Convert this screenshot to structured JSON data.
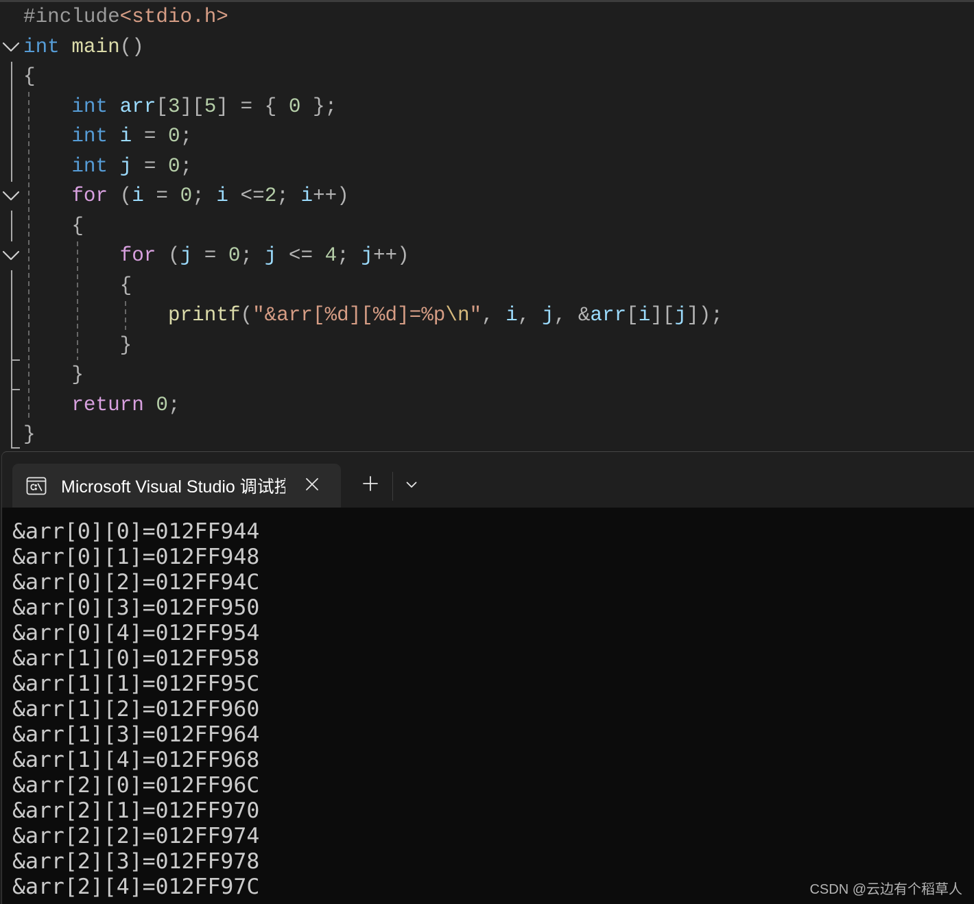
{
  "editor": {
    "colors": {
      "background": "#1e1e1e",
      "preproc": "#9b9b9b",
      "keyword": "#569cd6",
      "control": "#d8a0df",
      "function": "#dcdcaa",
      "variable": "#9cdcfe",
      "number": "#b5cea8",
      "string": "#d69d85",
      "escape": "#d7ba7d",
      "punct": "#b4b4b4"
    },
    "lines": [
      {
        "tokens": [
          {
            "text": "#include",
            "kind": "preproc"
          },
          {
            "text": "<stdio.h>",
            "kind": "string"
          }
        ]
      },
      {
        "tokens": [
          {
            "text": "int ",
            "kind": "keyword"
          },
          {
            "text": "main",
            "kind": "function"
          },
          {
            "text": "()",
            "kind": "punct"
          }
        ]
      },
      {
        "tokens": [
          {
            "text": "{",
            "kind": "punct"
          }
        ]
      },
      {
        "tokens": [
          {
            "text": "    int ",
            "kind": "keyword"
          },
          {
            "text": "arr",
            "kind": "variable"
          },
          {
            "text": "[",
            "kind": "punct"
          },
          {
            "text": "3",
            "kind": "number"
          },
          {
            "text": "][",
            "kind": "punct"
          },
          {
            "text": "5",
            "kind": "number"
          },
          {
            "text": "] = { ",
            "kind": "punct"
          },
          {
            "text": "0",
            "kind": "number"
          },
          {
            "text": " };",
            "kind": "punct"
          }
        ]
      },
      {
        "tokens": [
          {
            "text": "    int ",
            "kind": "keyword"
          },
          {
            "text": "i",
            "kind": "variable"
          },
          {
            "text": " = ",
            "kind": "punct"
          },
          {
            "text": "0",
            "kind": "number"
          },
          {
            "text": ";",
            "kind": "punct"
          }
        ]
      },
      {
        "tokens": [
          {
            "text": "    int ",
            "kind": "keyword"
          },
          {
            "text": "j",
            "kind": "variable"
          },
          {
            "text": " = ",
            "kind": "punct"
          },
          {
            "text": "0",
            "kind": "number"
          },
          {
            "text": ";",
            "kind": "punct"
          }
        ]
      },
      {
        "tokens": [
          {
            "text": "    for ",
            "kind": "control"
          },
          {
            "text": "(",
            "kind": "punct"
          },
          {
            "text": "i",
            "kind": "variable"
          },
          {
            "text": " = ",
            "kind": "punct"
          },
          {
            "text": "0",
            "kind": "number"
          },
          {
            "text": "; ",
            "kind": "punct"
          },
          {
            "text": "i",
            "kind": "variable"
          },
          {
            "text": " <=",
            "kind": "punct"
          },
          {
            "text": "2",
            "kind": "number"
          },
          {
            "text": "; ",
            "kind": "punct"
          },
          {
            "text": "i",
            "kind": "variable"
          },
          {
            "text": "++)",
            "kind": "punct"
          }
        ]
      },
      {
        "tokens": [
          {
            "text": "    {",
            "kind": "punct"
          }
        ]
      },
      {
        "tokens": [
          {
            "text": "        for ",
            "kind": "control"
          },
          {
            "text": "(",
            "kind": "punct"
          },
          {
            "text": "j",
            "kind": "variable"
          },
          {
            "text": " = ",
            "kind": "punct"
          },
          {
            "text": "0",
            "kind": "number"
          },
          {
            "text": "; ",
            "kind": "punct"
          },
          {
            "text": "j",
            "kind": "variable"
          },
          {
            "text": " <= ",
            "kind": "punct"
          },
          {
            "text": "4",
            "kind": "number"
          },
          {
            "text": "; ",
            "kind": "punct"
          },
          {
            "text": "j",
            "kind": "variable"
          },
          {
            "text": "++)",
            "kind": "punct"
          }
        ]
      },
      {
        "tokens": [
          {
            "text": "        {",
            "kind": "punct"
          }
        ]
      },
      {
        "tokens": [
          {
            "text": "            printf",
            "kind": "function"
          },
          {
            "text": "(",
            "kind": "punct"
          },
          {
            "text": "\"&arr[%d][%d]=%p",
            "kind": "string"
          },
          {
            "text": "\\n",
            "kind": "escape"
          },
          {
            "text": "\"",
            "kind": "string"
          },
          {
            "text": ", ",
            "kind": "punct"
          },
          {
            "text": "i",
            "kind": "variable"
          },
          {
            "text": ", ",
            "kind": "punct"
          },
          {
            "text": "j",
            "kind": "variable"
          },
          {
            "text": ", &",
            "kind": "punct"
          },
          {
            "text": "arr",
            "kind": "variable"
          },
          {
            "text": "[",
            "kind": "punct"
          },
          {
            "text": "i",
            "kind": "variable"
          },
          {
            "text": "][",
            "kind": "punct"
          },
          {
            "text": "j",
            "kind": "variable"
          },
          {
            "text": "]);",
            "kind": "punct"
          }
        ]
      },
      {
        "tokens": [
          {
            "text": "        }",
            "kind": "punct"
          }
        ]
      },
      {
        "tokens": [
          {
            "text": "    }",
            "kind": "punct"
          }
        ]
      },
      {
        "tokens": [
          {
            "text": "    return ",
            "kind": "control"
          },
          {
            "text": "0",
            "kind": "number"
          },
          {
            "text": ";",
            "kind": "punct"
          }
        ]
      },
      {
        "tokens": [
          {
            "text": "}",
            "kind": "punct"
          }
        ]
      }
    ],
    "gutter_icons": [
      "collapse-chevron-icon"
    ]
  },
  "terminal": {
    "colors": {
      "tab_row": "#1f1f1f",
      "active_tab": "#2b2b2b",
      "background": "#0c0c0c",
      "foreground": "#cccccc"
    },
    "tab": {
      "icon": "console-icon",
      "title": "Microsoft Visual Studio 调试控",
      "close_icon": "close-icon"
    },
    "new_tab_icon": "plus-icon",
    "dropdown_icon": "chevron-down-icon",
    "output": [
      "&arr[0][0]=012FF944",
      "&arr[0][1]=012FF948",
      "&arr[0][2]=012FF94C",
      "&arr[0][3]=012FF950",
      "&arr[0][4]=012FF954",
      "&arr[1][0]=012FF958",
      "&arr[1][1]=012FF95C",
      "&arr[1][2]=012FF960",
      "&arr[1][3]=012FF964",
      "&arr[1][4]=012FF968",
      "&arr[2][0]=012FF96C",
      "&arr[2][1]=012FF970",
      "&arr[2][2]=012FF974",
      "&arr[2][3]=012FF978",
      "&arr[2][4]=012FF97C"
    ]
  },
  "watermark": "CSDN @云边有个稻草人"
}
